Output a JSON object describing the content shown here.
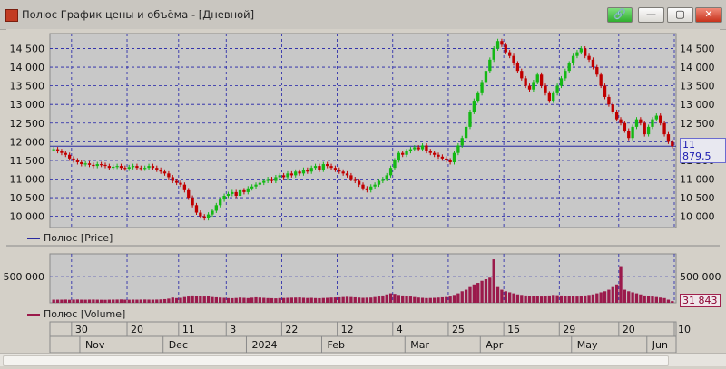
{
  "window": {
    "title": "Полюс График цены и объёма - [Дневной]",
    "buttons": {
      "link": "🔗",
      "minimize": "—",
      "maximize": "▢",
      "close": "✕"
    }
  },
  "price_pane": {
    "legend": "Полюс [Price]",
    "last_value": "11 879,5",
    "y_ticks": [
      "14 500",
      "14 000",
      "13 500",
      "13 000",
      "12 500",
      "12 000",
      "11 500",
      "11 000",
      "10 500",
      "10 000"
    ]
  },
  "volume_pane": {
    "legend": "Полюс [Volume]",
    "last_value": "31 843",
    "y_ticks": [
      "500 000"
    ]
  },
  "x_axis": {
    "days": [
      "30",
      "20",
      "11",
      "3",
      "22",
      "12",
      "4",
      "25",
      "15",
      "29",
      "20",
      "10"
    ],
    "months": [
      "Nov",
      "Dec",
      "2024",
      "Feb",
      "Mar",
      "Apr",
      "May",
      "Jun"
    ]
  },
  "colors": {
    "up": "#14b814",
    "down": "#c00000",
    "volume": "#9b1a4b",
    "grid": "#1f1fa8",
    "price_line": "#2a2aa0"
  },
  "chart_data": [
    {
      "type": "candlestick",
      "series": [
        {
          "name": "Полюс [Price]",
          "close": [
            11800,
            11750,
            11700,
            11650,
            11550,
            11500,
            11450,
            11400,
            11420,
            11380,
            11350,
            11400,
            11380,
            11350,
            11300,
            11330,
            11350,
            11300,
            11280,
            11320,
            11350,
            11300,
            11280,
            11300,
            11350,
            11300,
            11250,
            11200,
            11150,
            11050,
            10950,
            10900,
            10850,
            10700,
            10500,
            10300,
            10100,
            10000,
            9950,
            10050,
            10150,
            10300,
            10450,
            10550,
            10600,
            10650,
            10550,
            10700,
            10650,
            10750,
            10800,
            10850,
            10900,
            10950,
            11000,
            10950,
            11050,
            11100,
            11050,
            11150,
            11100,
            11200,
            11150,
            11250,
            11200,
            11300,
            11350,
            11250,
            11400,
            11350,
            11300,
            11250,
            11200,
            11150,
            11100,
            11000,
            10950,
            10850,
            10750,
            10700,
            10800,
            10850,
            10950,
            11000,
            11100,
            11300,
            11500,
            11700,
            11650,
            11750,
            11800,
            11850,
            11800,
            11900,
            11750,
            11700,
            11650,
            11600,
            11550,
            11500,
            11450,
            11700,
            11900,
            12100,
            12400,
            12800,
            13100,
            13300,
            13600,
            13900,
            14200,
            14500,
            14700,
            14600,
            14400,
            14300,
            14100,
            13900,
            13700,
            13500,
            13400,
            13600,
            13800,
            13500,
            13300,
            13100,
            13300,
            13500,
            13700,
            13900,
            14100,
            14300,
            14400,
            14500,
            14300,
            14200,
            14000,
            13800,
            13500,
            13200,
            13000,
            12800,
            12600,
            12500,
            12300,
            12100,
            12400,
            12600,
            12500,
            12200,
            12400,
            12600,
            12700,
            12500,
            12200,
            12000,
            11880
          ]
        }
      ],
      "ylim": [
        9700,
        14900
      ]
    },
    {
      "type": "bar",
      "series": [
        {
          "name": "Полюс [Volume]",
          "values": [
            60000,
            60000,
            60000,
            62000,
            58000,
            61000,
            63000,
            60000,
            59000,
            61000,
            62000,
            60000,
            58000,
            57000,
            60000,
            61000,
            62000,
            64000,
            60000,
            59000,
            61000,
            60000,
            62000,
            63000,
            61000,
            60000,
            62000,
            65000,
            70000,
            80000,
            100000,
            90000,
            95000,
            110000,
            120000,
            140000,
            130000,
            125000,
            120000,
            130000,
            110000,
            105000,
            100000,
            95000,
            90000,
            88000,
            92000,
            100000,
            95000,
            90000,
            98000,
            105000,
            100000,
            95000,
            90000,
            88000,
            85000,
            90000,
            92000,
            95000,
            98000,
            100000,
            102000,
            96000,
            92000,
            95000,
            90000,
            88000,
            92000,
            95000,
            100000,
            102000,
            105000,
            110000,
            115000,
            110000,
            105000,
            100000,
            95000,
            98000,
            100000,
            110000,
            120000,
            140000,
            160000,
            180000,
            170000,
            150000,
            140000,
            130000,
            120000,
            110000,
            100000,
            95000,
            90000,
            92000,
            95000,
            100000,
            105000,
            110000,
            120000,
            150000,
            180000,
            220000,
            250000,
            300000,
            350000,
            380000,
            420000,
            450000,
            480000,
            830000,
            300000,
            250000,
            220000,
            200000,
            180000,
            160000,
            150000,
            140000,
            135000,
            130000,
            125000,
            120000,
            130000,
            140000,
            150000,
            145000,
            140000,
            135000,
            130000,
            125000,
            120000,
            130000,
            140000,
            150000,
            160000,
            180000,
            200000,
            220000,
            250000,
            300000,
            350000,
            700000,
            250000,
            220000,
            200000,
            180000,
            160000,
            140000,
            130000,
            120000,
            110000,
            100000,
            90000,
            60000,
            31843
          ]
        }
      ],
      "ylim": [
        0,
        900000
      ]
    }
  ]
}
